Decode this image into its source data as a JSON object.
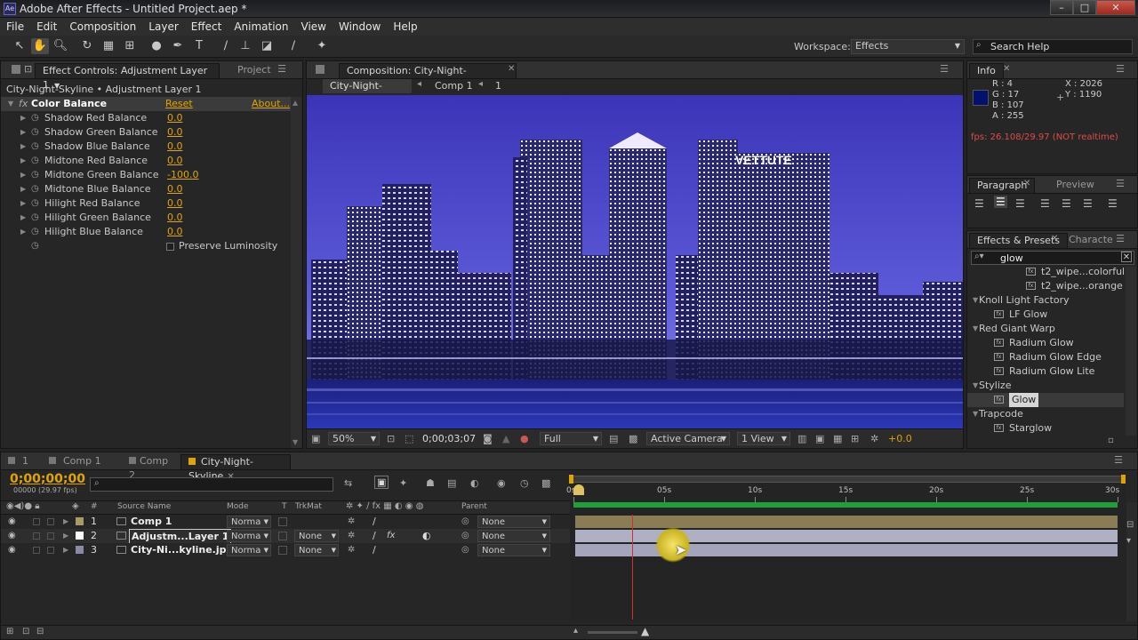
{
  "window": {
    "title": "Adobe After Effects - Untitled Project.aep *",
    "app_icon": "Ae",
    "min": "–",
    "max": "□",
    "close": "✕"
  },
  "menu": [
    "File",
    "Edit",
    "Composition",
    "Layer",
    "Effect",
    "Animation",
    "View",
    "Window",
    "Help"
  ],
  "toolbar": {
    "workspace_label": "Workspace:",
    "workspace_value": "Effects",
    "search_placeholder": "Search Help"
  },
  "effect_controls": {
    "tab_label": "Effect Controls: Adjustment Layer 1",
    "project_tab": "Project",
    "layer_path": "City-Night-Skyline • Adjustment Layer 1",
    "effect_name": "Color Balance",
    "reset": "Reset",
    "about": "About...",
    "params": [
      {
        "name": "Shadow Red Balance",
        "value": "0.0"
      },
      {
        "name": "Shadow Green Balance",
        "value": "0.0"
      },
      {
        "name": "Shadow Blue Balance",
        "value": "0.0"
      },
      {
        "name": "Midtone Red Balance",
        "value": "0.0"
      },
      {
        "name": "Midtone Green Balance",
        "value": "-100.0"
      },
      {
        "name": "Midtone Blue Balance",
        "value": "0.0"
      },
      {
        "name": "Hilight Red Balance",
        "value": "0.0"
      },
      {
        "name": "Hilight Green Balance",
        "value": "0.0"
      },
      {
        "name": "Hilight Blue Balance",
        "value": "0.0"
      }
    ],
    "preserve": "Preserve Luminosity"
  },
  "composition": {
    "tab_label": "Composition: City-Night-Skyline",
    "breadcrumb": [
      "City-Night-Skyline",
      "Comp 1",
      "1"
    ],
    "sign_text": "VETTUTE",
    "footer": {
      "zoom": "50%",
      "timecode": "0;00;03;07",
      "resolution": "Full",
      "view": "Active Camera",
      "views": "1 View",
      "offset": "+0.0"
    }
  },
  "info": {
    "tab": "Info",
    "r": "R : 4",
    "g": "G : 17",
    "b": "B : 107",
    "a": "A : 255",
    "x": "X : 2026",
    "y": "Y : 1190",
    "fps": "fps: 26.108/29.97 (NOT realtime)",
    "swatch": "#04116b"
  },
  "paragraph": {
    "tab": "Paragraph",
    "preview_tab": "Preview"
  },
  "effects_presets": {
    "tab": "Effects & Presets",
    "char_tab": "Characte",
    "search": "glow",
    "items": [
      {
        "text": "t2_wipe...colorful",
        "level": 2
      },
      {
        "text": "t2_wipe...orange",
        "level": 2
      },
      {
        "text": "Knoll Light Factory",
        "level": 0
      },
      {
        "text": "LF Glow",
        "level": 1
      },
      {
        "text": "Red Giant Warp",
        "level": 0
      },
      {
        "text": "Radium Glow",
        "level": 1
      },
      {
        "text": "Radium Glow Edge",
        "level": 1
      },
      {
        "text": "Radium Glow Lite",
        "level": 1
      },
      {
        "text": "Stylize",
        "level": 0
      },
      {
        "text": "Glow",
        "level": 1,
        "selected": true
      },
      {
        "text": "Trapcode",
        "level": 0
      },
      {
        "text": "Starglow",
        "level": 1
      }
    ]
  },
  "timeline": {
    "tabs": [
      "1",
      "Comp 1",
      "Comp 2",
      "City-Night-Skyline"
    ],
    "timecode": "0;00;00;00",
    "fps_note": "00000 (29.97 fps)",
    "headers": {
      "num": "#",
      "source": "Source Name",
      "mode": "Mode",
      "t": "T",
      "trkmat": "TrkMat",
      "parent": "Parent"
    },
    "ruler": [
      "0s",
      "05s",
      "10s",
      "15s",
      "20s",
      "25s",
      "30s"
    ],
    "layers": [
      {
        "num": "1",
        "name": "Comp 1",
        "mode": "Norma",
        "trkmat": "",
        "parent": "None",
        "color": "#a99a66",
        "bar": "#8a7d55"
      },
      {
        "num": "2",
        "name": "Adjustm...Layer 1",
        "mode": "Norma",
        "trkmat": "None",
        "parent": "None",
        "color": "#ffffff",
        "bar": "#b0b0c4"
      },
      {
        "num": "3",
        "name": "City-Ni...kyline.jpg",
        "mode": "Norma",
        "trkmat": "None",
        "parent": "None",
        "color": "#8a8aa6",
        "bar": "#a4a4bc"
      }
    ]
  }
}
